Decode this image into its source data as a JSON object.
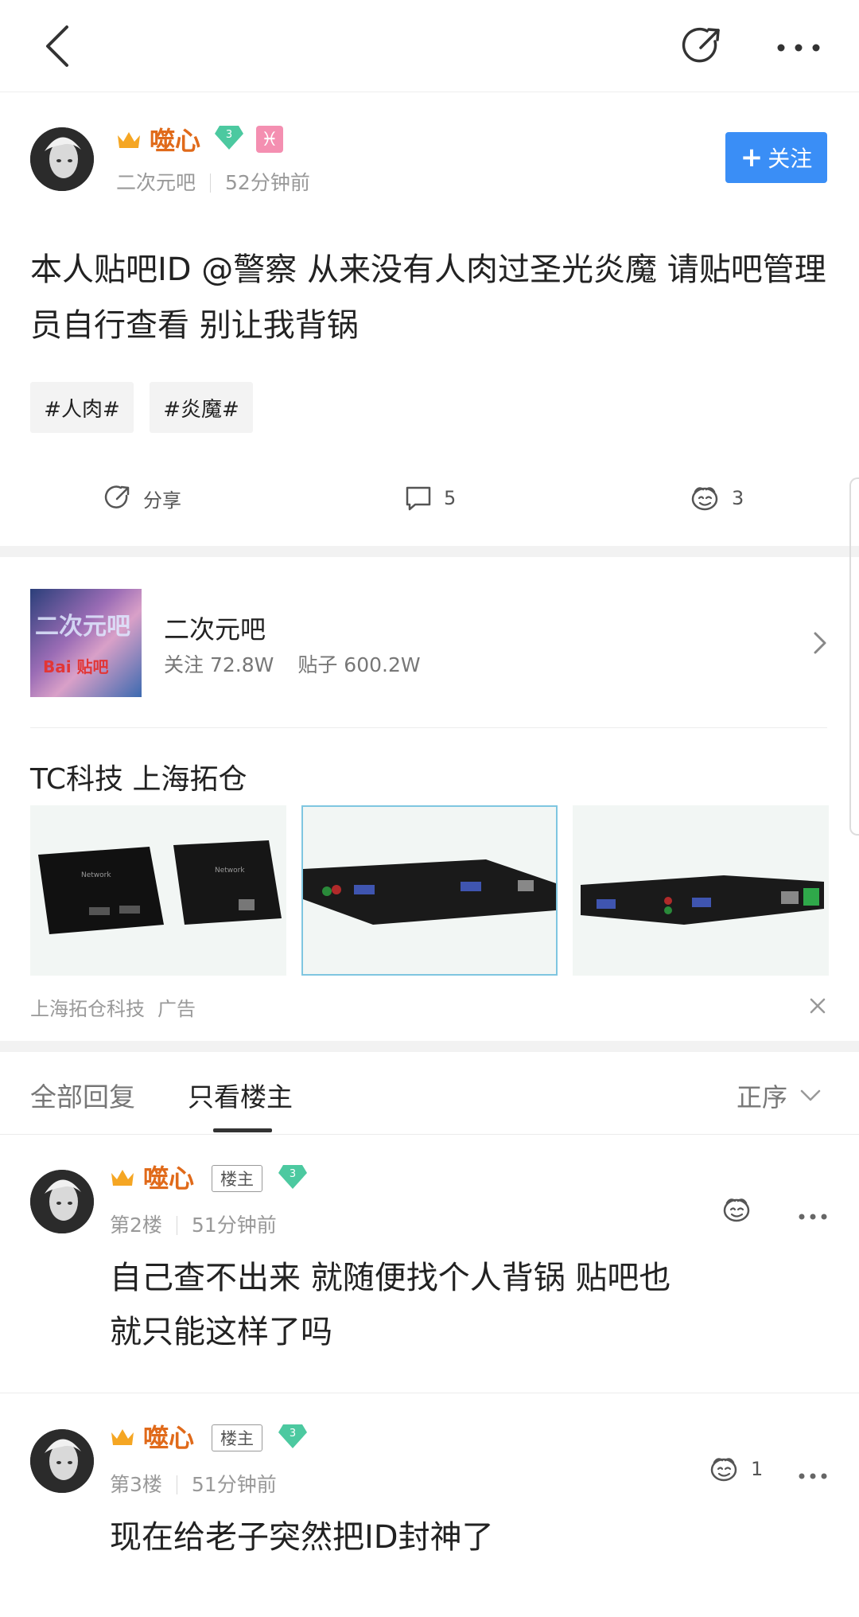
{
  "nav": {
    "back_icon": "chevron-left-icon",
    "share_icon": "share-arrow-icon",
    "more_icon": "more-dots-icon"
  },
  "post": {
    "author": "噬心",
    "level": "3",
    "zodiac": "♓",
    "forum": "二次元吧",
    "time": "52分钟前",
    "follow_label": "关注",
    "follow_plus": "+",
    "content": "本人贴吧ID @警察 从来没有人肉过圣光炎魔 请贴吧管理员自行查看 别让我背锅",
    "tags": [
      "#人肉#",
      "#炎魔#"
    ],
    "share_label": "分享",
    "comment_count": "5",
    "like_count": "3"
  },
  "forum_card": {
    "name": "二次元吧",
    "followers": "关注 72.8W",
    "posts": "贴子 600.2W",
    "image_text": "二次元吧",
    "image_brand": "Bai 贴吧"
  },
  "ad": {
    "title": "TC科技 上海拓仓",
    "advertiser": "上海拓仓科技",
    "ad_label": "广告"
  },
  "tabs": {
    "all": "全部回复",
    "op_only": "只看楼主",
    "sort": "正序"
  },
  "replies": [
    {
      "author": "噬心",
      "badge": "楼主",
      "level": "3",
      "floor": "第2楼",
      "time": "51分钟前",
      "text_line1": "自己查不出来 就随便找个人背锅 贴吧也",
      "text_line2": "就只能这样了吗",
      "like_count": ""
    },
    {
      "author": "噬心",
      "badge": "楼主",
      "level": "3",
      "floor": "第3楼",
      "time": "51分钟前",
      "text_line1": "现在给老子突然把ID封神了",
      "text_line2": "",
      "like_count": "1"
    }
  ],
  "colors": {
    "accent_blue": "#3a8ef6",
    "username_orange": "#e06a1a",
    "level_green": "#4cc9a0"
  }
}
